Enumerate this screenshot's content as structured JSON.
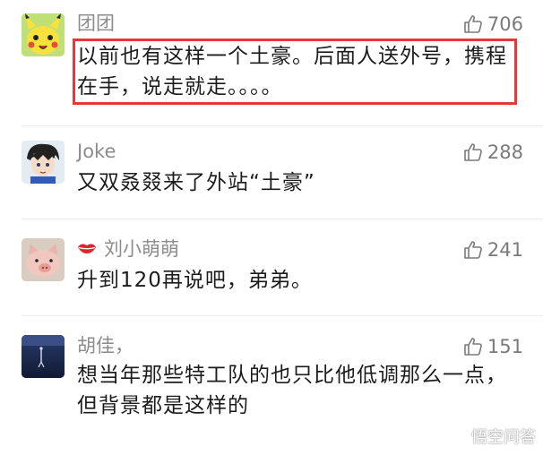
{
  "comments": [
    {
      "username": "团团",
      "lines": [
        "以前也有这样一个土豪。后面人送外号，携程",
        "在手，说走就走。。。。"
      ],
      "likes": "706"
    },
    {
      "username": "Joke",
      "lines": [
        "又双叒叕来了外站“土豪”"
      ],
      "likes": "288"
    },
    {
      "username": "刘小萌萌",
      "lines": [
        "升到120再说吧，弟弟。"
      ],
      "likes": "241"
    },
    {
      "username": "胡佳，",
      "lines": [
        "想当年那些特工队的也只比他低调那么一点，",
        "但背景都是这样的"
      ],
      "likes": "151"
    }
  ],
  "watermark": {
    "text": "悟空问答",
    "icon": "wukong-logo-icon"
  },
  "colors": {
    "highlight": "#e3383e",
    "username": "#8c8c8c",
    "text": "#1c1c1c",
    "like": "#7a7a7a",
    "heart": "#e0242b"
  }
}
